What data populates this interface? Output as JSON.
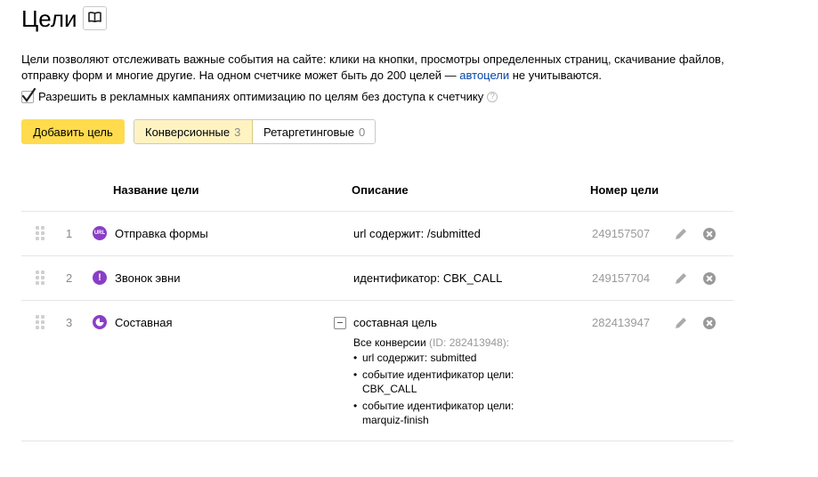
{
  "header": {
    "title": "Цели"
  },
  "intro": {
    "text_before_link": "Цели позволяют отслеживать важные события на сайте: клики на кнопки, просмотры определенных страниц, скачивание файлов, отправку форм и многие другие. На одном счетчике может быть до 200 целей — ",
    "link": "автоцели",
    "text_after_link": " не учитываются."
  },
  "permission_checkbox": {
    "label": "Разрешить в рекламных кампаниях оптимизацию по целям без доступа к счетчику",
    "checked": true
  },
  "toolbar": {
    "add_goal_label": "Добавить цель",
    "tabs": [
      {
        "label": "Конверсионные",
        "count": "3",
        "active": true
      },
      {
        "label": "Ретаргетинговые",
        "count": "0",
        "active": false
      }
    ]
  },
  "table": {
    "headers": {
      "name": "Название цели",
      "description": "Описание",
      "id": "Номер цели"
    },
    "rows": [
      {
        "index": "1",
        "icon": "url-icon",
        "name": "Отправка формы",
        "description": "url содержит: /submitted",
        "goal_id": "249157507"
      },
      {
        "index": "2",
        "icon": "exclamation-icon",
        "name": "Звонок эвни",
        "description": "идентификатор: CBK_CALL",
        "goal_id": "249157704"
      },
      {
        "index": "3",
        "icon": "composite-icon",
        "name": "Составная",
        "description": "составная цель",
        "goal_id": "282413947",
        "details": {
          "step_title": "Все конверсии",
          "step_id": "(ID: 282413948):",
          "items": [
            "url содержит: submitted",
            "событие идентификатор цели: CBK_CALL",
            "событие идентификатор цели: marquiz-finish"
          ]
        }
      }
    ]
  },
  "colors": {
    "accent_yellow": "#ffdb4d",
    "active_tab_bg": "#fff3c2",
    "link": "#0447a6",
    "goal_icon": "#8a3ec7"
  }
}
